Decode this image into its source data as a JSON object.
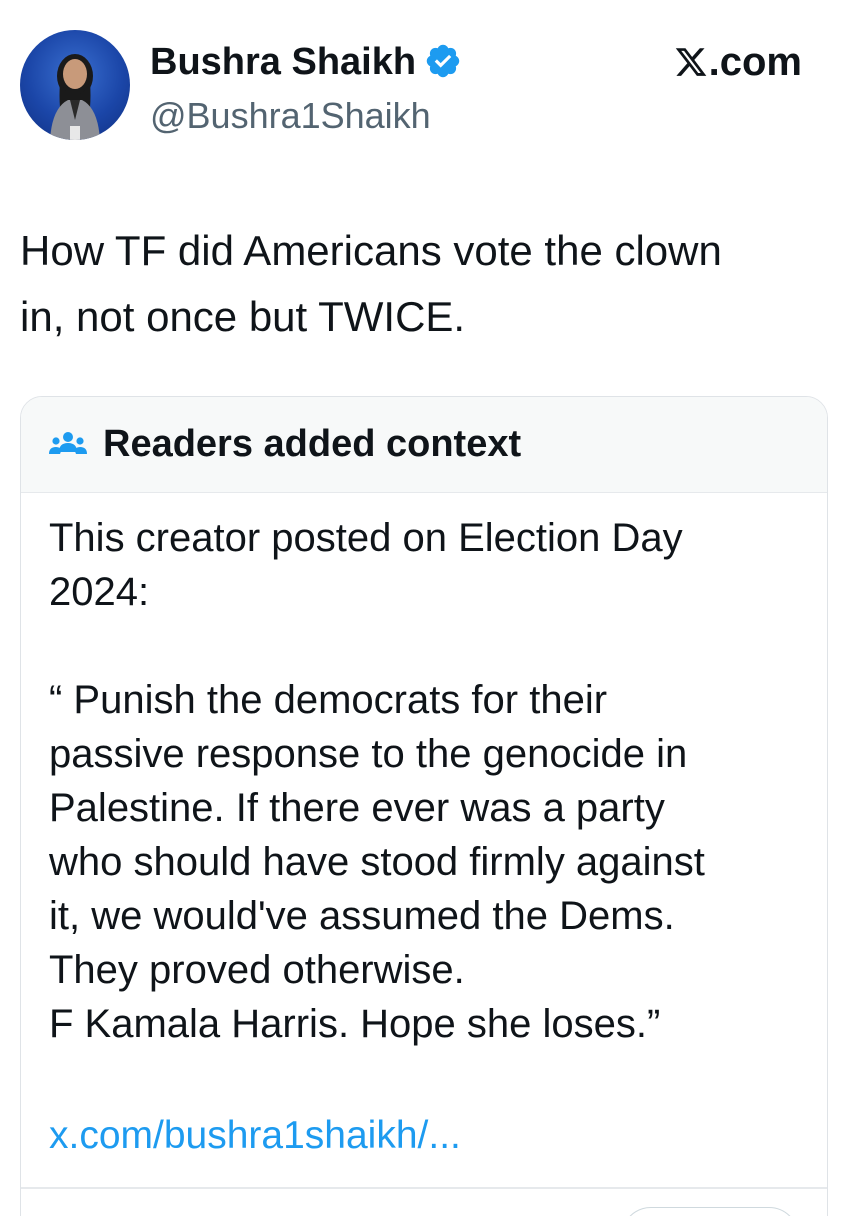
{
  "author": {
    "display_name": "Bushra Shaikh",
    "handle": "@Bushra1Shaikh",
    "verified": true
  },
  "brand": {
    "label": ".com"
  },
  "tweet": {
    "lines": [
      "How TF did Americans vote the clown",
      "in, not once but TWICE."
    ]
  },
  "community_note": {
    "title": "Readers added context",
    "intro_lines": [
      "This creator posted on Election Day",
      "2024:"
    ],
    "quote_lines": [
      "“ Punish the democrats for their",
      "passive response to the genocide in",
      "Palestine. If there ever was a party",
      "who should have stood firmly against",
      "it, we would've assumed the Dems.",
      "They proved otherwise.",
      "F Kamala Harris. Hope she loses.”"
    ],
    "link": "x.com/bushra1shaikh/..."
  },
  "colors": {
    "text": "#0f1419",
    "secondary_text": "#536471",
    "link": "#1d9bf0",
    "verified_badge": "#1d9bf0",
    "note_header_bg": "#f7f9f9",
    "border": "#dfe3e7"
  },
  "icons": {
    "verified": "verified-badge-icon",
    "brand": "x-logo-icon",
    "note": "community-notes-icon"
  }
}
